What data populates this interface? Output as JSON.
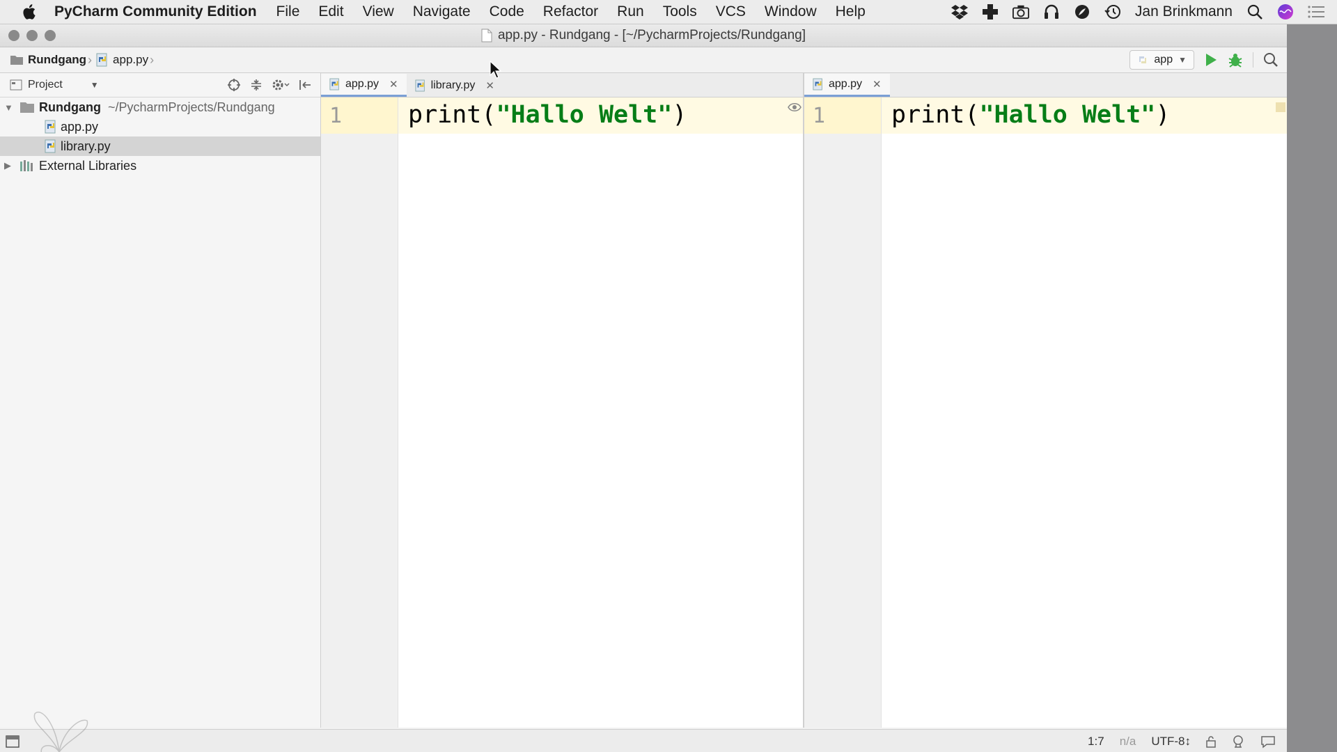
{
  "menubar": {
    "app_name": "PyCharm Community Edition",
    "menus": [
      "File",
      "Edit",
      "View",
      "Navigate",
      "Code",
      "Refactor",
      "Run",
      "Tools",
      "VCS",
      "Window",
      "Help"
    ],
    "user": "Jan Brinkmann"
  },
  "window": {
    "title": "app.py - Rundgang - [~/PycharmProjects/Rundgang]"
  },
  "navbar": {
    "project_crumb": "Rundgang",
    "file_crumb": "app.py",
    "run_config": "app"
  },
  "project_panel": {
    "title": "Project",
    "root_name": "Rundgang",
    "root_path": "~/PycharmProjects/Rundgang",
    "files": [
      "app.py",
      "library.py"
    ],
    "selected_file": "library.py",
    "external": "External Libraries"
  },
  "editor_left": {
    "tabs": [
      {
        "label": "app.py",
        "active": true
      },
      {
        "label": "library.py",
        "active": false
      }
    ],
    "line_number": "1",
    "code_func": "print(",
    "code_string": "\"Hallo Welt\"",
    "code_close": ")"
  },
  "editor_right": {
    "tabs": [
      {
        "label": "app.py",
        "active": true
      }
    ],
    "line_number": "1",
    "code_func": "print(",
    "code_string": "\"Hallo Welt\"",
    "code_close": ")"
  },
  "statusbar": {
    "position": "1:7",
    "na": "n/a",
    "encoding": "UTF-8↕"
  },
  "colors": {
    "string": "#067d17",
    "current_line": "#fffae3",
    "tab_underline": "#7b9fd4"
  }
}
